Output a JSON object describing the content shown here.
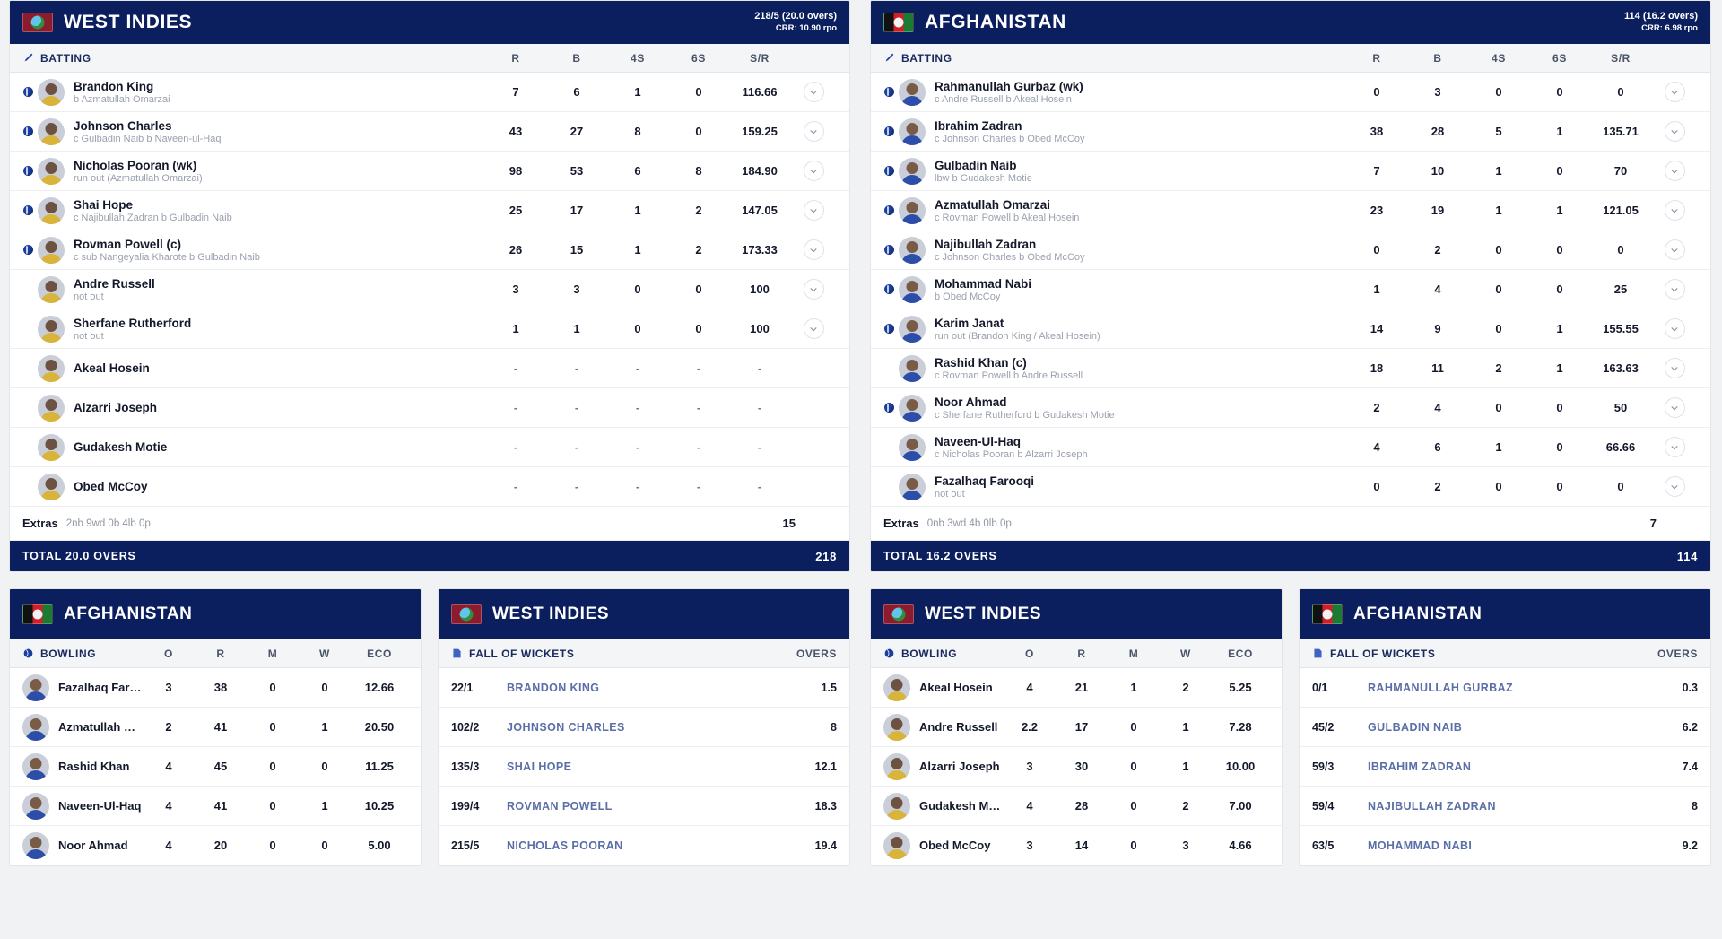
{
  "innings": [
    {
      "team": "WEST INDIES",
      "flag": "west-indies-flag-icon",
      "score": "218/5 (20.0 overs)",
      "crr": "CRR: 10.90 rpo",
      "batting_header": {
        "label": "BATTING",
        "icon": "bat-icon",
        "cols": [
          "R",
          "B",
          "4S",
          "6S",
          "S/R"
        ]
      },
      "batsmen": [
        {
          "name": "Brandon King",
          "how": "b Azmatullah Omarzai",
          "out": true,
          "r": "7",
          "b": "6",
          "f": "1",
          "s": "0",
          "sr": "116.66"
        },
        {
          "name": "Johnson Charles",
          "how": "c Gulbadin Naib b Naveen-ul-Haq",
          "out": true,
          "r": "43",
          "b": "27",
          "f": "8",
          "s": "0",
          "sr": "159.25"
        },
        {
          "name": "Nicholas Pooran (wk)",
          "how": "run out (Azmatullah Omarzai)",
          "out": true,
          "r": "98",
          "b": "53",
          "f": "6",
          "s": "8",
          "sr": "184.90"
        },
        {
          "name": "Shai Hope",
          "how": "c Najibullah Zadran b Gulbadin Naib",
          "out": true,
          "r": "25",
          "b": "17",
          "f": "1",
          "s": "2",
          "sr": "147.05"
        },
        {
          "name": "Rovman Powell (c)",
          "how": "c sub Nangeyalia Kharote b Gulbadin Naib",
          "out": true,
          "r": "26",
          "b": "15",
          "f": "1",
          "s": "2",
          "sr": "173.33"
        },
        {
          "name": "Andre Russell",
          "how": "not out",
          "out": false,
          "r": "3",
          "b": "3",
          "f": "0",
          "s": "0",
          "sr": "100"
        },
        {
          "name": "Sherfane Rutherford",
          "how": "not out",
          "out": false,
          "r": "1",
          "b": "1",
          "f": "0",
          "s": "0",
          "sr": "100"
        },
        {
          "name": "Akeal Hosein",
          "how": "",
          "out": false,
          "r": "-",
          "b": "-",
          "f": "-",
          "s": "-",
          "sr": "-"
        },
        {
          "name": "Alzarri Joseph",
          "how": "",
          "out": false,
          "r": "-",
          "b": "-",
          "f": "-",
          "s": "-",
          "sr": "-"
        },
        {
          "name": "Gudakesh Motie",
          "how": "",
          "out": false,
          "r": "-",
          "b": "-",
          "f": "-",
          "s": "-",
          "sr": "-"
        },
        {
          "name": "Obed McCoy",
          "how": "",
          "out": false,
          "r": "-",
          "b": "-",
          "f": "-",
          "s": "-",
          "sr": "-"
        }
      ],
      "extras": {
        "label": "Extras",
        "detail": "2nb 9wd 0b 4lb 0p",
        "value": "15"
      },
      "total": {
        "label": "TOTAL  20.0 OVERS",
        "value": "218"
      }
    },
    {
      "team": "AFGHANISTAN",
      "flag": "afghanistan-flag-icon",
      "score": "114 (16.2 overs)",
      "crr": "CRR: 6.98 rpo",
      "batting_header": {
        "label": "BATTING",
        "icon": "bat-icon",
        "cols": [
          "R",
          "B",
          "4S",
          "6S",
          "S/R"
        ]
      },
      "batsmen": [
        {
          "name": "Rahmanullah Gurbaz (wk)",
          "how": "c Andre Russell b Akeal Hosein",
          "out": true,
          "r": "0",
          "b": "3",
          "f": "0",
          "s": "0",
          "sr": "0"
        },
        {
          "name": "Ibrahim Zadran",
          "how": "c Johnson Charles b Obed McCoy",
          "out": true,
          "r": "38",
          "b": "28",
          "f": "5",
          "s": "1",
          "sr": "135.71"
        },
        {
          "name": "Gulbadin Naib",
          "how": "lbw b Gudakesh Motie",
          "out": true,
          "r": "7",
          "b": "10",
          "f": "1",
          "s": "0",
          "sr": "70"
        },
        {
          "name": "Azmatullah Omarzai",
          "how": "c Rovman Powell b Akeal Hosein",
          "out": true,
          "r": "23",
          "b": "19",
          "f": "1",
          "s": "1",
          "sr": "121.05"
        },
        {
          "name": "Najibullah Zadran",
          "how": "c Johnson Charles b Obed McCoy",
          "out": true,
          "r": "0",
          "b": "2",
          "f": "0",
          "s": "0",
          "sr": "0"
        },
        {
          "name": "Mohammad Nabi",
          "how": "b Obed McCoy",
          "out": true,
          "r": "1",
          "b": "4",
          "f": "0",
          "s": "0",
          "sr": "25"
        },
        {
          "name": "Karim Janat",
          "how": "run out (Brandon King / Akeal Hosein)",
          "out": true,
          "r": "14",
          "b": "9",
          "f": "0",
          "s": "1",
          "sr": "155.55"
        },
        {
          "name": "Rashid Khan (c)",
          "how": "c Rovman Powell b Andre Russell",
          "out": false,
          "r": "18",
          "b": "11",
          "f": "2",
          "s": "1",
          "sr": "163.63"
        },
        {
          "name": "Noor Ahmad",
          "how": "c Sherfane Rutherford b Gudakesh Motie",
          "out": true,
          "r": "2",
          "b": "4",
          "f": "0",
          "s": "0",
          "sr": "50"
        },
        {
          "name": "Naveen-Ul-Haq",
          "how": "c Nicholas Pooran b Alzarri Joseph",
          "out": false,
          "r": "4",
          "b": "6",
          "f": "1",
          "s": "0",
          "sr": "66.66"
        },
        {
          "name": "Fazalhaq Farooqi",
          "how": "not out",
          "out": false,
          "r": "0",
          "b": "2",
          "f": "0",
          "s": "0",
          "sr": "0"
        }
      ],
      "extras": {
        "label": "Extras",
        "detail": "0nb 3wd 4b 0lb 0p",
        "value": "7"
      },
      "total": {
        "label": "TOTAL  16.2 OVERS",
        "value": "114"
      }
    }
  ],
  "bottom": [
    {
      "bowling": {
        "team": "AFGHANISTAN",
        "flag": "afghanistan-flag-icon",
        "header": {
          "label": "BOWLING",
          "icon": "ball-icon",
          "cols": [
            "O",
            "R",
            "M",
            "W",
            "ECO"
          ]
        },
        "rows": [
          {
            "name": "Fazalhaq Farooqi",
            "o": "3",
            "r": "38",
            "m": "0",
            "w": "0",
            "eco": "12.66"
          },
          {
            "name": "Azmatullah Omarzai",
            "o": "2",
            "r": "41",
            "m": "0",
            "w": "1",
            "eco": "20.50"
          },
          {
            "name": "Rashid Khan",
            "o": "4",
            "r": "45",
            "m": "0",
            "w": "0",
            "eco": "11.25"
          },
          {
            "name": "Naveen-Ul-Haq",
            "o": "4",
            "r": "41",
            "m": "0",
            "w": "1",
            "eco": "10.25"
          },
          {
            "name": "Noor Ahmad",
            "o": "4",
            "r": "20",
            "m": "0",
            "w": "0",
            "eco": "5.00"
          }
        ]
      },
      "fow": {
        "team": "WEST INDIES",
        "flag": "west-indies-flag-icon",
        "header": {
          "label": "FALL OF WICKETS",
          "icon": "wicket-icon",
          "overs_col": "OVERS"
        },
        "rows": [
          {
            "score": "22/1",
            "player": "BRANDON KING",
            "over": "1.5"
          },
          {
            "score": "102/2",
            "player": "JOHNSON CHARLES",
            "over": "8"
          },
          {
            "score": "135/3",
            "player": "SHAI HOPE",
            "over": "12.1"
          },
          {
            "score": "199/4",
            "player": "ROVMAN POWELL",
            "over": "18.3"
          },
          {
            "score": "215/5",
            "player": "NICHOLAS POORAN",
            "over": "19.4"
          }
        ]
      }
    },
    {
      "bowling": {
        "team": "WEST INDIES",
        "flag": "west-indies-flag-icon",
        "header": {
          "label": "BOWLING",
          "icon": "ball-icon",
          "cols": [
            "O",
            "R",
            "M",
            "W",
            "ECO"
          ]
        },
        "rows": [
          {
            "name": "Akeal Hosein",
            "o": "4",
            "r": "21",
            "m": "1",
            "w": "2",
            "eco": "5.25"
          },
          {
            "name": "Andre Russell",
            "o": "2.2",
            "r": "17",
            "m": "0",
            "w": "1",
            "eco": "7.28"
          },
          {
            "name": "Alzarri Joseph",
            "o": "3",
            "r": "30",
            "m": "0",
            "w": "1",
            "eco": "10.00"
          },
          {
            "name": "Gudakesh Motie",
            "o": "4",
            "r": "28",
            "m": "0",
            "w": "2",
            "eco": "7.00"
          },
          {
            "name": "Obed McCoy",
            "o": "3",
            "r": "14",
            "m": "0",
            "w": "3",
            "eco": "4.66"
          }
        ]
      },
      "fow": {
        "team": "AFGHANISTAN",
        "flag": "afghanistan-flag-icon",
        "header": {
          "label": "FALL OF WICKETS",
          "icon": "wicket-icon",
          "overs_col": "OVERS"
        },
        "rows": [
          {
            "score": "0/1",
            "player": "RAHMANULLAH GURBAZ",
            "over": "0.3"
          },
          {
            "score": "45/2",
            "player": "GULBADIN NAIB",
            "over": "6.2"
          },
          {
            "score": "59/3",
            "player": "IBRAHIM ZADRAN",
            "over": "7.4"
          },
          {
            "score": "59/4",
            "player": "NAJIBULLAH ZADRAN",
            "over": "8"
          },
          {
            "score": "63/5",
            "player": "MOHAMMAD NABI",
            "over": "9.2"
          }
        ]
      }
    }
  ],
  "colors": {
    "brand_navy": "#0b1f5e",
    "accent_blue": "#5a6fa8",
    "muted": "#9aa1ae"
  }
}
